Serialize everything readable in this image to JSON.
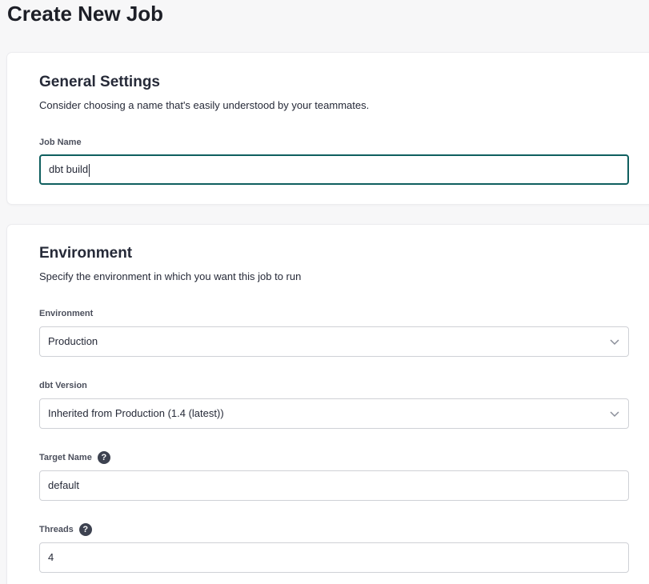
{
  "page": {
    "title": "Create New Job"
  },
  "general": {
    "title": "General Settings",
    "description": "Consider choosing a name that's easily understood by your teammates.",
    "job_name_label": "Job Name",
    "job_name_value": "dbt build"
  },
  "environment": {
    "title": "Environment",
    "description": "Specify the environment in which you want this job to run",
    "environment_label": "Environment",
    "environment_value": "Production",
    "dbt_version_label": "dbt Version",
    "dbt_version_value": "Inherited from Production (1.4 (latest))",
    "target_name_label": "Target Name",
    "target_name_value": "default",
    "threads_label": "Threads",
    "threads_value": "4"
  },
  "icons": {
    "help": "question-circle-icon",
    "chevron": "chevron-down-icon"
  },
  "colors": {
    "focus_border": "#0f5f5f",
    "help_icon_bg": "#3d4250"
  }
}
